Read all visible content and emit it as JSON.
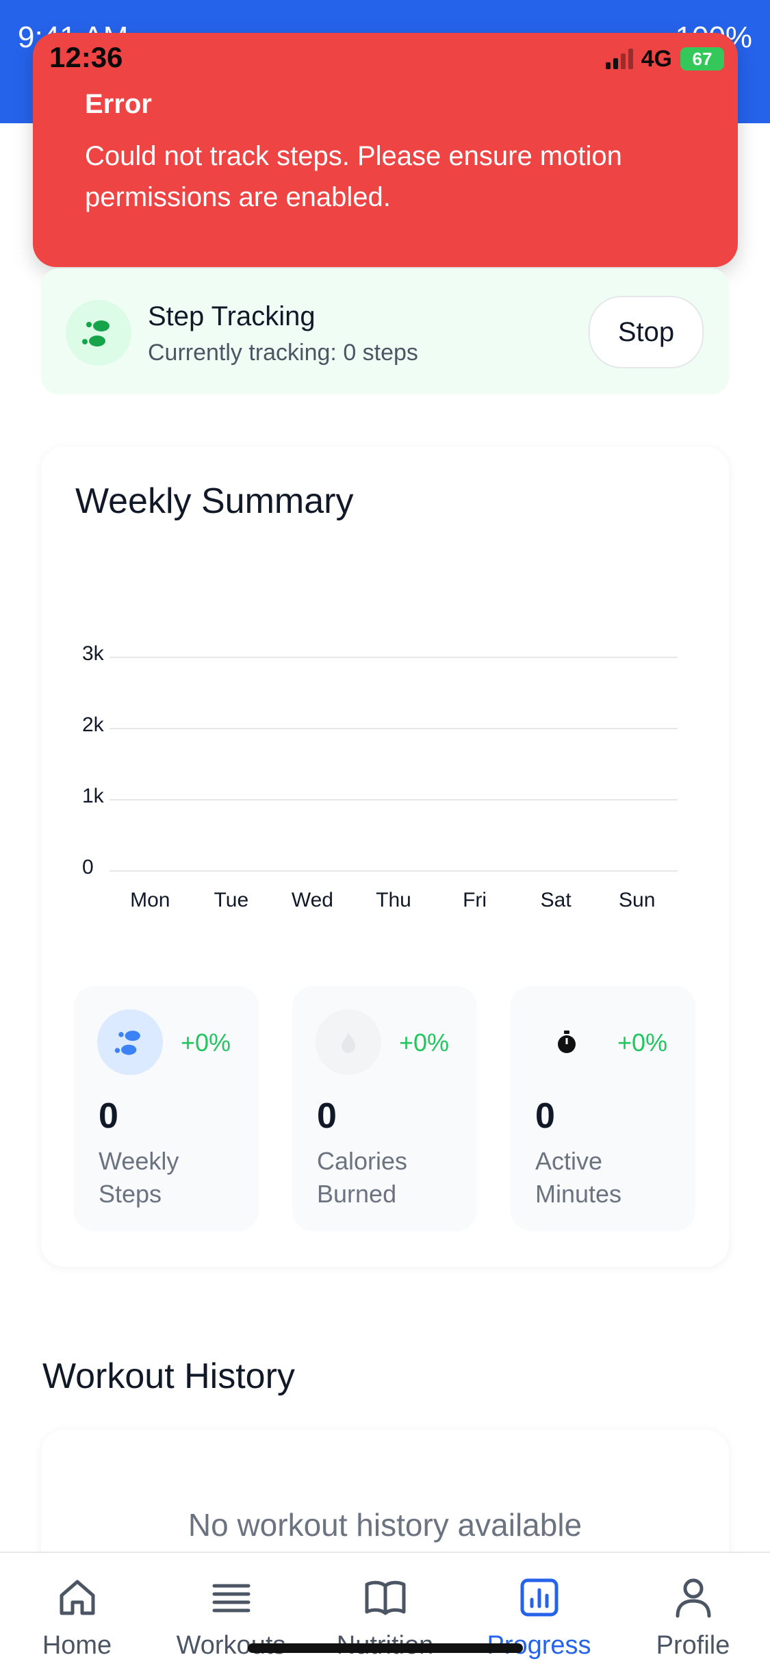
{
  "app_statusbar": {
    "time": "9:41 AM",
    "battery_text": "100%"
  },
  "system_status": {
    "time": "12:36",
    "network": "4G",
    "battery": "67"
  },
  "toast": {
    "title": "Error",
    "message": "Could not track steps. Please ensure motion permissions are enabled.",
    "color": "#ef4444"
  },
  "step_tracking": {
    "title": "Step Tracking",
    "status": "Currently tracking: 0 steps",
    "stop_label": "Stop",
    "icon": "footsteps-icon"
  },
  "weekly_summary": {
    "title": "Weekly Summary",
    "stats": [
      {
        "icon": "footsteps-icon",
        "change": "+0%",
        "value": "0",
        "label": "Weekly Steps"
      },
      {
        "icon": "flame-icon",
        "change": "+0%",
        "value": "0",
        "label": "Calories Burned"
      },
      {
        "icon": "stopwatch-icon",
        "change": "+0%",
        "value": "0",
        "label": "Active Minutes"
      }
    ]
  },
  "chart_data": {
    "type": "bar",
    "categories": [
      "Mon",
      "Tue",
      "Wed",
      "Thu",
      "Fri",
      "Sat",
      "Sun"
    ],
    "values": [
      0,
      0,
      0,
      0,
      0,
      0,
      0
    ],
    "y_ticks": [
      "0",
      "1k",
      "2k",
      "3k"
    ],
    "ylim": [
      0,
      3000
    ],
    "grid": true,
    "title": "",
    "xlabel": "",
    "ylabel": ""
  },
  "workout_history": {
    "title": "Workout History",
    "empty_text": "No workout history available"
  },
  "tabbar": {
    "tabs": [
      {
        "label": "Home",
        "icon": "home-icon",
        "active": false
      },
      {
        "label": "Workouts",
        "icon": "list-icon",
        "active": false
      },
      {
        "label": "Nutrition",
        "icon": "book-icon",
        "active": false
      },
      {
        "label": "Progress",
        "icon": "bar-chart-icon",
        "active": true
      },
      {
        "label": "Profile",
        "icon": "person-icon",
        "active": false
      }
    ],
    "active_color": "#2563eb"
  }
}
